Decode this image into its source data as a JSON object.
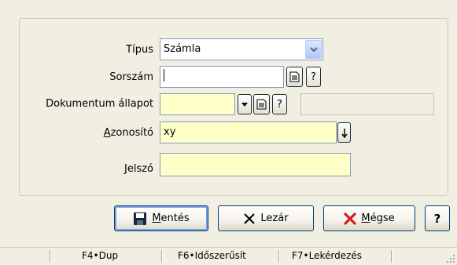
{
  "form": {
    "tipus": {
      "label": "Típus",
      "value": "Számla"
    },
    "sorszam": {
      "label": "Sorszám",
      "value": ""
    },
    "dokumentum_allapot": {
      "label": "Dokumentum állapot",
      "value": "",
      "extra_value": ""
    },
    "azonosito": {
      "label_underlined": "A",
      "label_rest": "zonosító",
      "value": "xy"
    },
    "jelszo": {
      "label_underlined": "J",
      "label_rest": "elszó",
      "value": ""
    },
    "help_glyph": "?"
  },
  "buttons": {
    "save": {
      "underlined": "M",
      "rest": "entés"
    },
    "close": {
      "label": "Lezár"
    },
    "cancel": {
      "underlined": "M",
      "rest": "égse"
    },
    "help": {
      "label": "?"
    }
  },
  "statusbar": {
    "items": [
      "F4•Dup",
      "F6•Időszerűsít",
      "F7•Lekérdezés"
    ]
  },
  "colors": {
    "field_required": "#ffffc8",
    "cancel_icon": "#d21e1e"
  }
}
